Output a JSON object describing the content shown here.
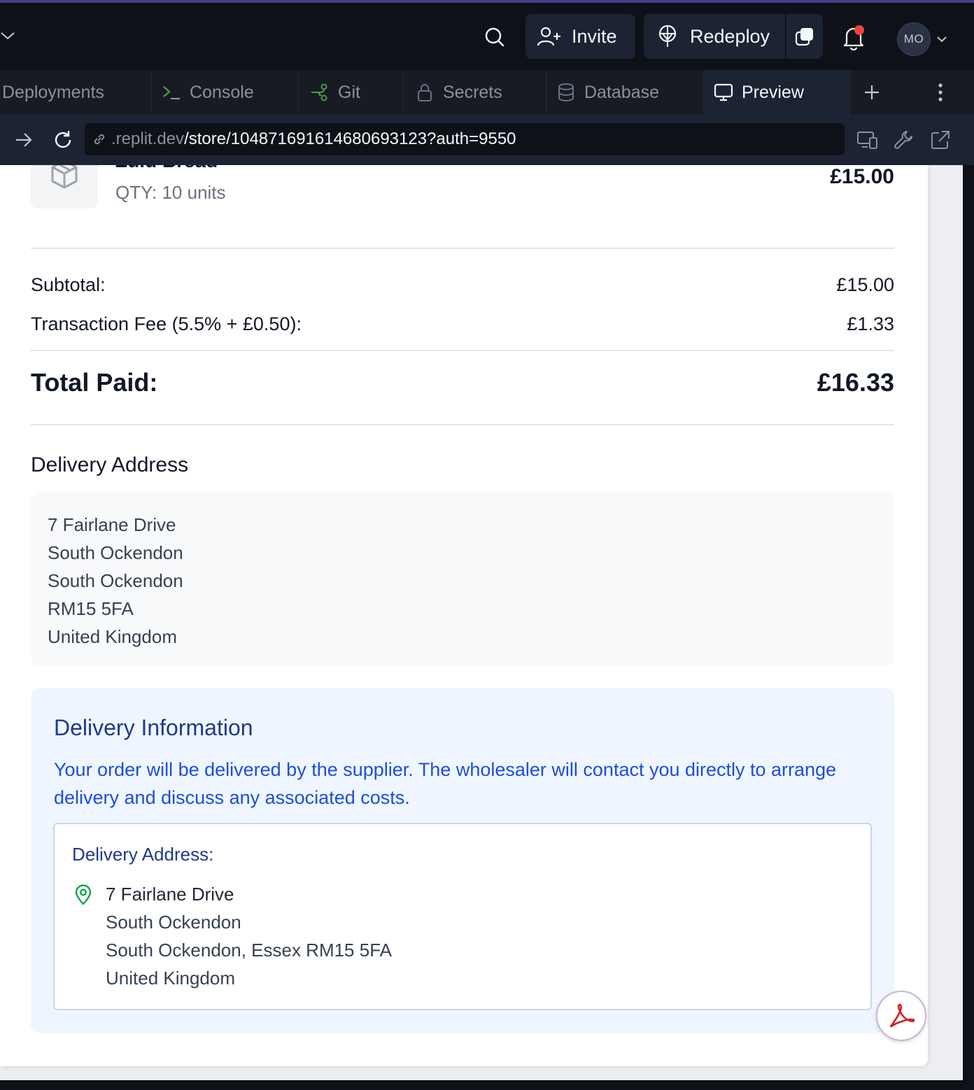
{
  "topbar": {
    "invite_label": "Invite",
    "redeploy_label": "Redeploy",
    "avatar_initials": "MO",
    "notification_dot_color": "#f2433d"
  },
  "tabs": [
    {
      "label": "Deployments",
      "icon": "deployments-icon",
      "active": false
    },
    {
      "label": "Console",
      "icon": "console-icon",
      "active": false
    },
    {
      "label": "Git",
      "icon": "git-icon",
      "active": false
    },
    {
      "label": "Secrets",
      "icon": "lock-icon",
      "active": false
    },
    {
      "label": "Database",
      "icon": "database-icon",
      "active": false
    },
    {
      "label": "Preview",
      "icon": "monitor-icon",
      "active": true
    }
  ],
  "urlbar": {
    "host": ".replit.dev",
    "path": "/store/10487169161468069312​3?auth=9550"
  },
  "order": {
    "item": {
      "name": "Zulu Bread",
      "qty": "QTY: 10 units",
      "price": "£15.00"
    },
    "subtotal_label": "Subtotal:",
    "subtotal_value": "£15.00",
    "fee_label": "Transaction Fee (5.5% + £0.50):",
    "fee_value": "£1.33",
    "total_label": "Total Paid:",
    "total_value": "£16.33"
  },
  "delivery_address": {
    "heading": "Delivery Address",
    "lines": [
      "7 Fairlane Drive",
      "South Ockendon",
      "South Ockendon",
      "RM15 5FA",
      "United Kingdom"
    ]
  },
  "delivery_info": {
    "title": "Delivery Information",
    "text": "Your order will be delivered by the supplier. The wholesaler will contact you directly to arrange delivery and discuss any associated costs.",
    "address_title": "Delivery Address:",
    "address_lines": [
      "7 Fairlane Drive",
      "South Ockendon",
      "South Ockendon, Essex RM15 5FA",
      "United Kingdom"
    ]
  },
  "colors": {
    "accent_blue": "#1d4ed8",
    "pin_green": "#16a34a",
    "pdf_red": "#d01f26"
  }
}
